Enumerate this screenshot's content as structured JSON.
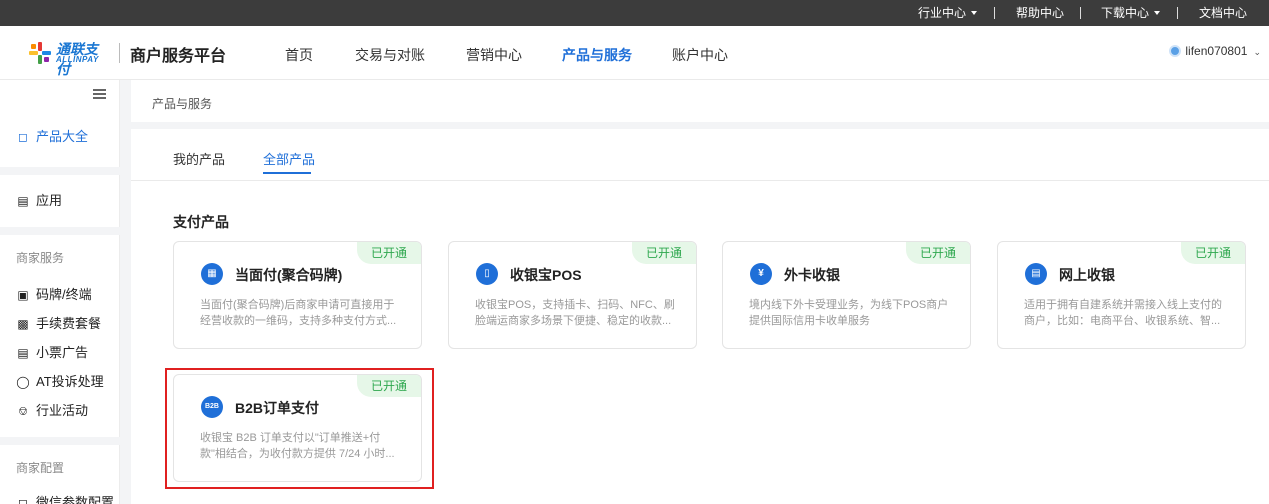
{
  "topbar": {
    "links": [
      "行业中心",
      "帮助中心",
      "下载中心",
      "文档中心"
    ]
  },
  "header": {
    "logo_cn": "通联支付",
    "logo_en": "ALLINPAY",
    "platform": "商户服务平台",
    "nav": [
      "首页",
      "交易与对账",
      "营销中心",
      "产品与服务",
      "账户中心"
    ],
    "active_nav": "产品与服务",
    "username": "lifen070801"
  },
  "sidebar": {
    "items": [
      {
        "label": "产品大全",
        "icon": "cube-icon"
      },
      {
        "label": "应用",
        "icon": "archive-icon"
      },
      {
        "label": "码牌/终端",
        "icon": "terminal-icon"
      },
      {
        "label": "手续费套餐",
        "icon": "gift-icon"
      },
      {
        "label": "小票广告",
        "icon": "receipt-icon"
      },
      {
        "label": "AT投诉处理",
        "icon": "shield-icon"
      },
      {
        "label": "行业活动",
        "icon": "cart-icon"
      },
      {
        "label": "微信参数配置",
        "icon": "cube-icon"
      }
    ],
    "groups": [
      "商家服务",
      "商家配置"
    ]
  },
  "breadcrumb": "产品与服务",
  "tabs": [
    "我的产品",
    "全部产品"
  ],
  "active_tab": "全部产品",
  "section_title": "支付产品",
  "cards": [
    {
      "title": "当面付(聚合码牌)",
      "desc": "当面付(聚合码牌)后商家申请可直接用于经营收款的一维码，支持多种支付方式...",
      "badge": "已开通",
      "icon": "scan-icon"
    },
    {
      "title": "收银宝POS",
      "desc": "收银宝POS，支持插卡、扫码、NFC、刷脸端运商家多场景下便捷、稳定的收款...",
      "badge": "已开通",
      "icon": "pos-icon"
    },
    {
      "title": "外卡收银",
      "desc": "境内线下外卡受理业务，为线下POS商户提供国际信用卡收单服务",
      "badge": "已开通",
      "icon": "moneybag-icon"
    },
    {
      "title": "网上收银",
      "desc": "适用于拥有自建系统并需接入线上支付的商户，比如：电商平台、收银系统、智...",
      "badge": "已开通",
      "icon": "wallet-icon"
    },
    {
      "title": "B2B订单支付",
      "desc": "收银宝 B2B 订单支付以\"订单推送+付款\"相结合，为收付款方提供 7/24 小时...",
      "badge": "已开通",
      "icon": "b2b-icon",
      "icon_text": "B2B"
    }
  ],
  "colors": {
    "accent": "#1f6fd8",
    "badge_bg": "#e6f7e8",
    "badge_text": "#2fa84f",
    "highlight": "#e02020"
  }
}
